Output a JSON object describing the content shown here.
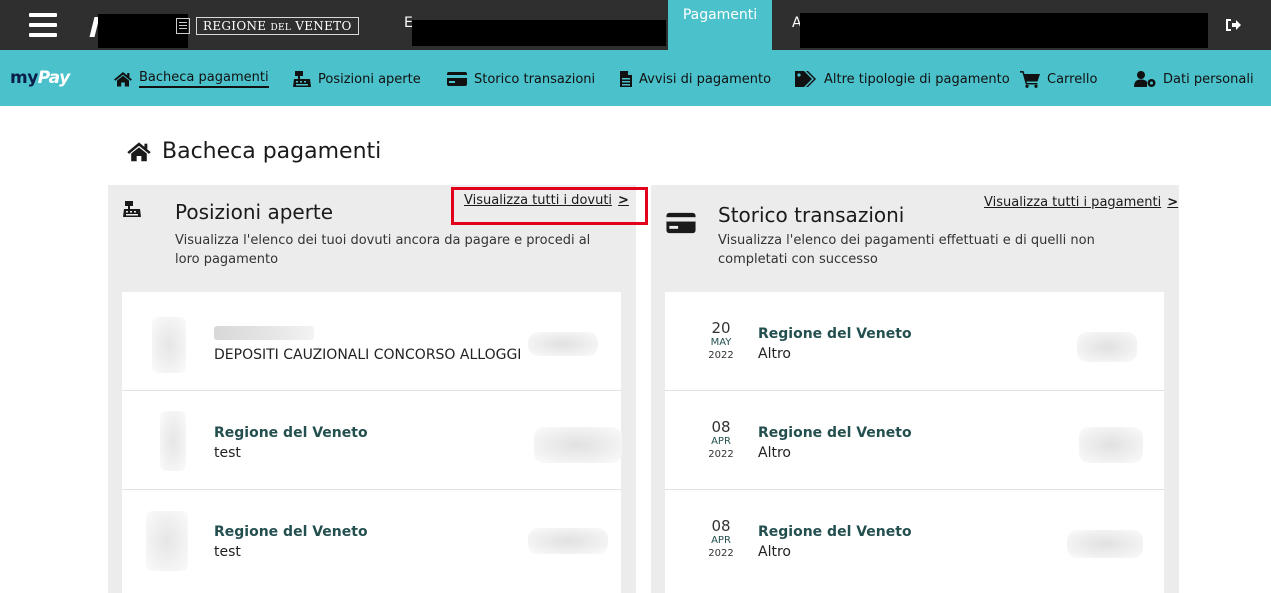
{
  "header": {
    "menu_icon": "hamburger-menu-icon",
    "region_prefix": "REGIONE",
    "region_small": "DEL",
    "region_suffix": "VENETO",
    "active_tab": "Pagamenti",
    "logout_icon": "logout-icon",
    "fragments": [
      "E",
      "A"
    ]
  },
  "brand": {
    "logo_my": "my",
    "logo_pay": "Pay"
  },
  "nav": {
    "items": [
      {
        "label": "Bacheca pagamenti",
        "icon": "home-icon",
        "active": true
      },
      {
        "label": "Posizioni aperte",
        "icon": "cash-register-icon",
        "active": false
      },
      {
        "label": "Storico transazioni",
        "icon": "credit-card-icon",
        "active": false
      },
      {
        "label": "Avvisi di pagamento",
        "icon": "document-icon",
        "active": false
      },
      {
        "label": "Altre tipologie di pagamento",
        "icon": "tags-icon",
        "active": false
      },
      {
        "label": "Carrello",
        "icon": "cart-icon",
        "active": false
      },
      {
        "label": "Dati personali",
        "icon": "user-cog-icon",
        "active": false
      }
    ]
  },
  "page": {
    "title": "Bacheca pagamenti",
    "title_icon": "home-icon"
  },
  "open_positions": {
    "icon": "cash-register-icon",
    "title": "Posizioni aperte",
    "description": "Visualizza l'elenco dei tuoi dovuti ancora da pagare e procedi al loro pagamento",
    "link": "Visualizza tutti i dovuti",
    "link_chevron": ">",
    "rows": [
      {
        "title": "",
        "subtitle": "DEPOSITI CAUZIONALI CONCORSO ALLOGGI"
      },
      {
        "title": "Regione del Veneto",
        "subtitle": "test"
      },
      {
        "title": "Regione del Veneto",
        "subtitle": "test"
      }
    ]
  },
  "history": {
    "icon": "credit-card-icon",
    "title": "Storico transazioni",
    "description": "Visualizza l'elenco dei pagamenti effettuati e di quelli non completati con successo",
    "link": "Visualizza tutti i pagamenti",
    "link_chevron": ">",
    "rows": [
      {
        "day": "20",
        "month": "MAY",
        "year": "2022",
        "title": "Regione del Veneto",
        "subtitle": "Altro"
      },
      {
        "day": "08",
        "month": "APR",
        "year": "2022",
        "title": "Regione del Veneto",
        "subtitle": "Altro"
      },
      {
        "day": "08",
        "month": "APR",
        "year": "2022",
        "title": "Regione del Veneto",
        "subtitle": "Altro"
      }
    ]
  },
  "colors": {
    "topbar": "#2f2f2f",
    "accent_teal": "#4bc1cb",
    "card_bg": "#ececec",
    "highlight_red": "#e3001b",
    "entity_title": "#244f4f"
  }
}
